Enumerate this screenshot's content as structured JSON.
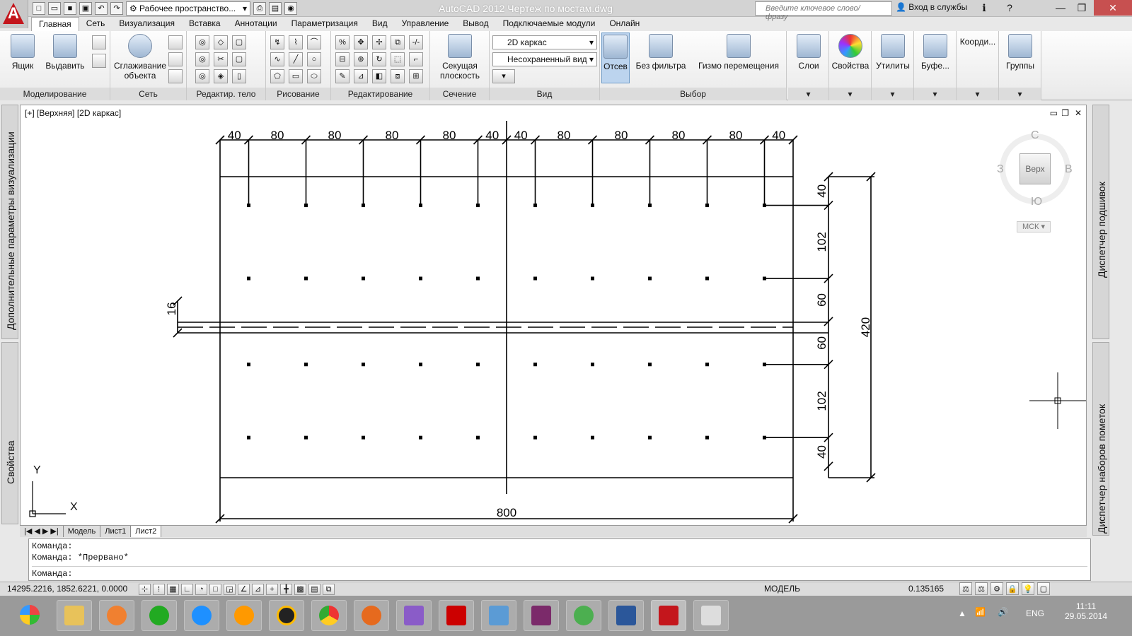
{
  "titlebar": {
    "title": "AutoCAD 2012    Чертеж по мостам.dwg",
    "workspace": "Рабочее пространство...",
    "search_placeholder": "Введите ключевое слово/фразу",
    "login": "Вход в службы"
  },
  "tabs": [
    "Главная",
    "Сеть",
    "Визуализация",
    "Вставка",
    "Аннотации",
    "Параметризация",
    "Вид",
    "Управление",
    "Вывод",
    "Подключаемые модули",
    "Онлайн"
  ],
  "ribbon": {
    "modeling": {
      "title": "Моделирование",
      "box": "Ящик",
      "extrude": "Выдавить"
    },
    "mesh": {
      "title": "Сеть",
      "smooth": "Сглаживание объекта"
    },
    "solid_edit": {
      "title": "Редактир. тело"
    },
    "draw": {
      "title": "Рисование"
    },
    "modify": {
      "title": "Редактирование"
    },
    "section": {
      "title": "Сечение",
      "plane": "Секущая плоскость"
    },
    "view": {
      "title": "Вид",
      "visual_style": "2D каркас",
      "named_view": "Несохраненный вид"
    },
    "selection": {
      "title": "Выбор",
      "culling": "Отсев",
      "nofilter": "Без фильтра",
      "gizmo": "Гизмо перемещения"
    },
    "layers": "Слои",
    "properties": "Свойства",
    "utilities": "Утилиты",
    "clipboard": "Буфе...",
    "coords": "Коорди...",
    "groups": "Группы"
  },
  "viewport": {
    "label": "[+] [Верхняя] [2D каркас]",
    "viewcube": {
      "top": "Верх",
      "north": "С",
      "south": "Ю",
      "west": "З",
      "east": "В",
      "wcs": "МСК"
    },
    "ucs": {
      "x": "X",
      "y": "Y"
    }
  },
  "drawing": {
    "top_dims": [
      "40",
      "80",
      "80",
      "80",
      "80",
      "40",
      "40",
      "80",
      "80",
      "80",
      "80",
      "40"
    ],
    "right_dims": [
      "40",
      "102",
      "60",
      "60",
      "102",
      "40"
    ],
    "total_height": "420",
    "total_width": "800",
    "left_dim": "16"
  },
  "left_palettes": [
    "Дополнительные параметры визуализации",
    "Свойства"
  ],
  "right_palettes": [
    "Диспетчер подшивок",
    "Диспетчер наборов пометок"
  ],
  "layout_tabs": [
    "Модель",
    "Лист1",
    "Лист2"
  ],
  "command": {
    "lines": [
      "Команда:",
      "Команда: *Прервано*"
    ],
    "prompt": "Команда:"
  },
  "status": {
    "coords": "14295.2216, 1852.6221, 0.0000",
    "model": "МОДЕЛЬ",
    "scale": "0.135165"
  },
  "tray": {
    "lang": "ENG",
    "time": "11:11",
    "date": "29.05.2014"
  }
}
